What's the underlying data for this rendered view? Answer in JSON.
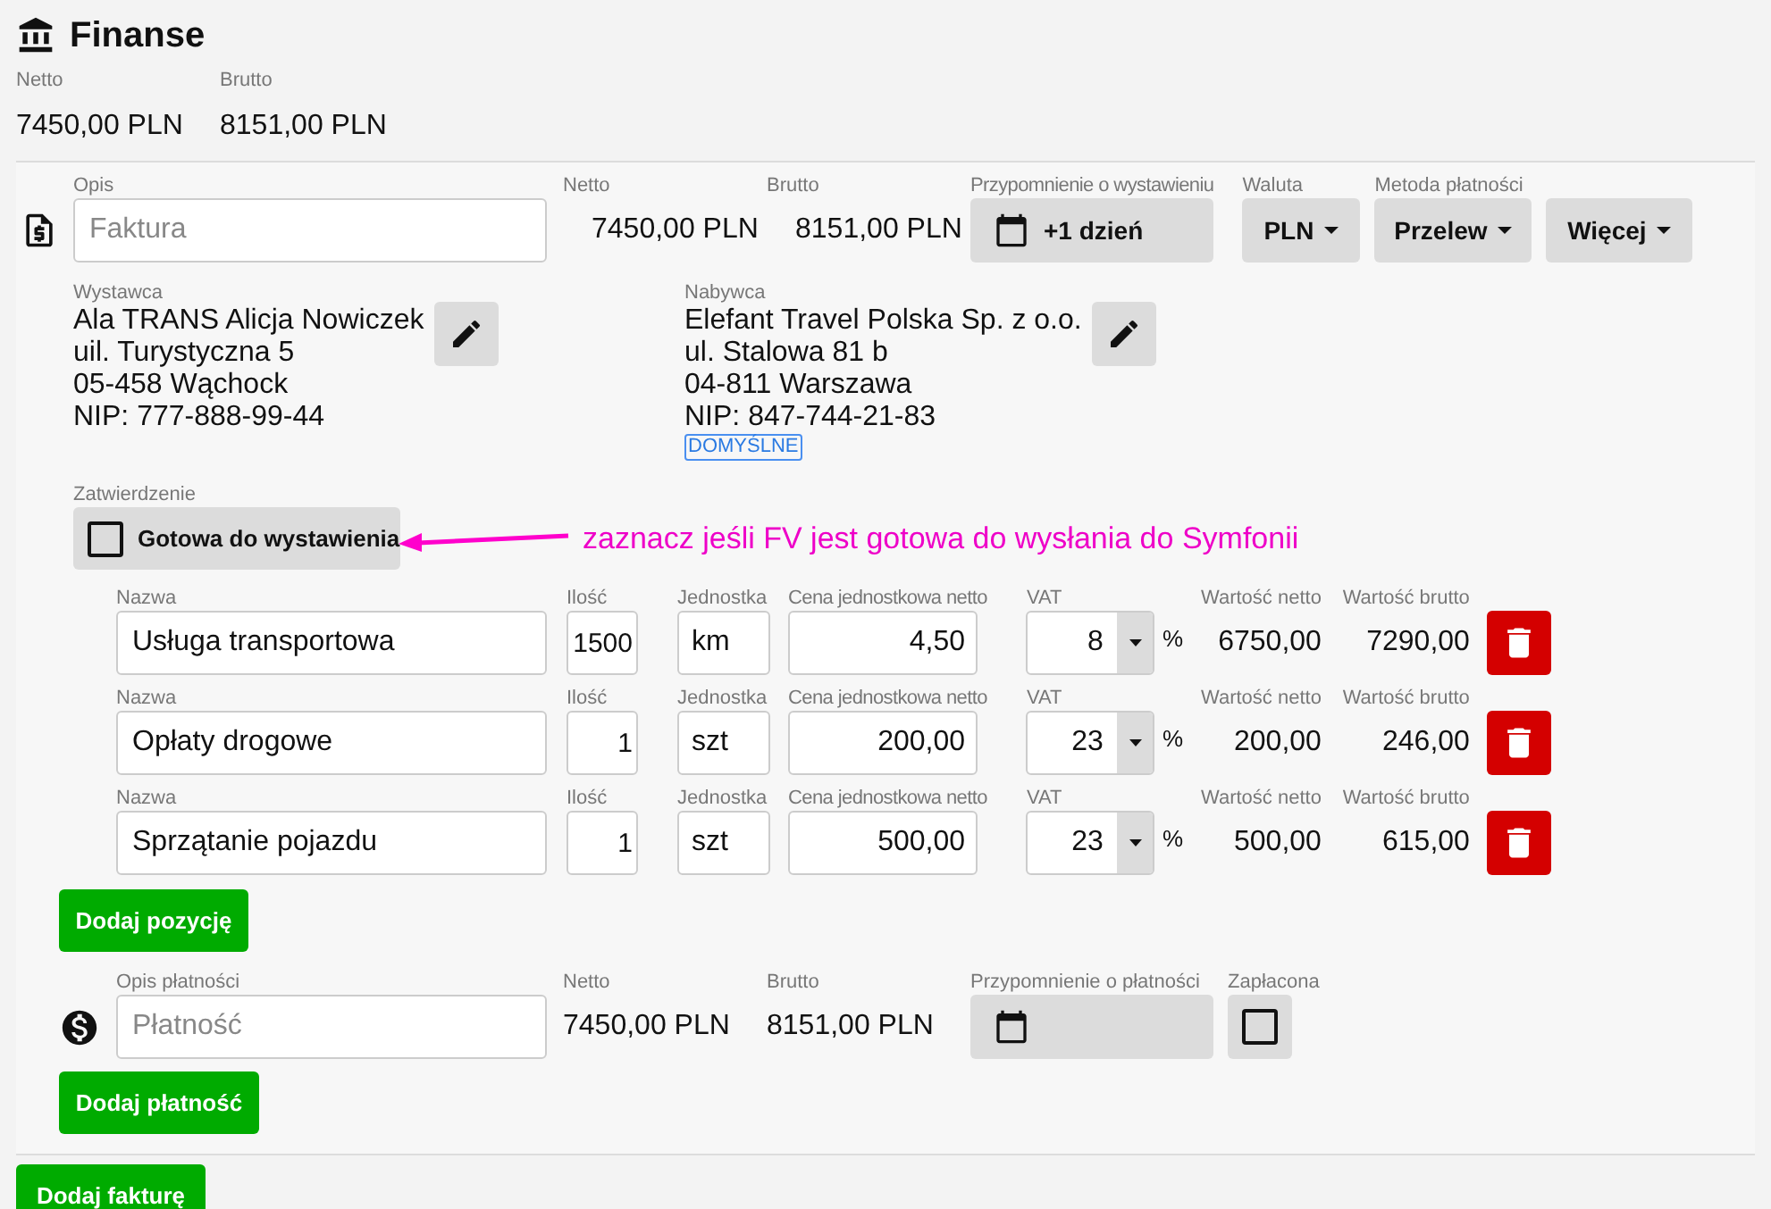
{
  "header": {
    "title": "Finanse"
  },
  "totals": [
    {
      "label": "Netto",
      "value": "7450,00 PLN"
    },
    {
      "label": "Brutto",
      "value": "8151,00 PLN"
    }
  ],
  "invoice": {
    "description": {
      "label": "Opis",
      "placeholder": "Faktura"
    },
    "netto": {
      "label": "Netto",
      "value": "7450,00 PLN"
    },
    "brutto": {
      "label": "Brutto",
      "value": "8151,00 PLN"
    },
    "reminder": {
      "label": "Przypomnienie o wystawieniu",
      "value": "+1 dzień"
    },
    "currency": {
      "label": "Waluta",
      "value": "PLN"
    },
    "payment_method": {
      "label": "Metoda płatności",
      "value": "Przelew"
    },
    "more_button": "Więcej",
    "seller": {
      "label": "Wystawca",
      "lines": [
        "Ala TRANS Alicja Nowiczek",
        "uil. Turystyczna 5",
        "05-458 Wąchock",
        "NIP: 777-888-99-44"
      ]
    },
    "buyer": {
      "label": "Nabywca",
      "lines": [
        "Elefant Travel Polska Sp. z o.o.",
        "ul. Stalowa 81 b",
        "04-811 Warszawa",
        "NIP: 847-744-21-83"
      ],
      "badge": "DOMYŚLNE"
    },
    "approval": {
      "label": "Zatwierdzenie",
      "checkbox_label": "Gotowa do wystawienia",
      "checked": false
    },
    "annotation": "zaznacz jeśli FV jest gotowa do wysłania do Symfonii",
    "items": [
      {
        "name_label": "Nazwa",
        "name": "Usługa transportowa",
        "qty_label": "Ilość",
        "qty": "1500",
        "unit_label": "Jednostka",
        "unit": "km",
        "price_label": "Cena jednostkowa netto",
        "price": "4,50",
        "vat_label": "VAT",
        "vat": "8",
        "vat_unit": "%",
        "net_label": "Wartość netto",
        "net": "6750,00",
        "gross_label": "Wartość brutto",
        "gross": "7290,00"
      },
      {
        "name_label": "Nazwa",
        "name": "Opłaty drogowe",
        "qty_label": "Ilość",
        "qty": "1",
        "unit_label": "Jednostka",
        "unit": "szt",
        "price_label": "Cena jednostkowa netto",
        "price": "200,00",
        "vat_label": "VAT",
        "vat": "23",
        "vat_unit": "%",
        "net_label": "Wartość netto",
        "net": "200,00",
        "gross_label": "Wartość brutto",
        "gross": "246,00"
      },
      {
        "name_label": "Nazwa",
        "name": "Sprzątanie pojazdu",
        "qty_label": "Ilość",
        "qty": "1",
        "unit_label": "Jednostka",
        "unit": "szt",
        "price_label": "Cena jednostkowa netto",
        "price": "500,00",
        "vat_label": "VAT",
        "vat": "23",
        "vat_unit": "%",
        "net_label": "Wartość netto",
        "net": "500,00",
        "gross_label": "Wartość brutto",
        "gross": "615,00"
      }
    ],
    "add_item_button": "Dodaj pozycję",
    "payment": {
      "description": {
        "label": "Opis płatności",
        "placeholder": "Płatność"
      },
      "netto": {
        "label": "Netto",
        "value": "7450,00 PLN"
      },
      "brutto": {
        "label": "Brutto",
        "value": "8151,00 PLN"
      },
      "reminder": {
        "label": "Przypomnienie o płatności"
      },
      "paid": {
        "label": "Zapłacona",
        "checked": false
      }
    },
    "add_payment_button": "Dodaj płatność"
  },
  "add_invoice_button": "Dodaj fakturę"
}
